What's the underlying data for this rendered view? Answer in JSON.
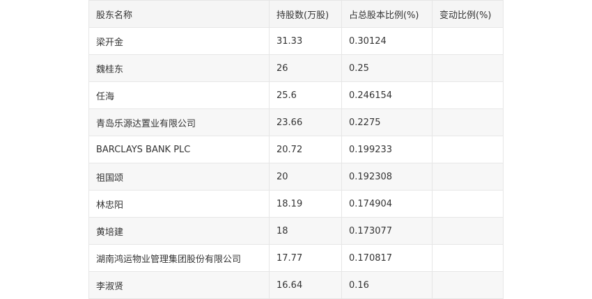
{
  "table": {
    "headers": [
      "股东名称",
      "持股数(万股)",
      "占总股本比例(%)",
      "变动比例(%)"
    ],
    "rows": [
      [
        "梁开金",
        "31.33",
        "0.30124",
        ""
      ],
      [
        "魏桂东",
        "26",
        "0.25",
        ""
      ],
      [
        "任海",
        "25.6",
        "0.246154",
        ""
      ],
      [
        "青岛乐源达置业有限公司",
        "23.66",
        "0.2275",
        ""
      ],
      [
        "BARCLAYS BANK PLC",
        "20.72",
        "0.199233",
        ""
      ],
      [
        "祖国颂",
        "20",
        "0.192308",
        ""
      ],
      [
        "林忠阳",
        "18.19",
        "0.174904",
        ""
      ],
      [
        "黄培建",
        "18",
        "0.173077",
        ""
      ],
      [
        "湖南鸿运物业管理集团股份有限公司",
        "17.77",
        "0.170817",
        ""
      ],
      [
        "李淑贤",
        "16.64",
        "0.16",
        ""
      ]
    ]
  }
}
